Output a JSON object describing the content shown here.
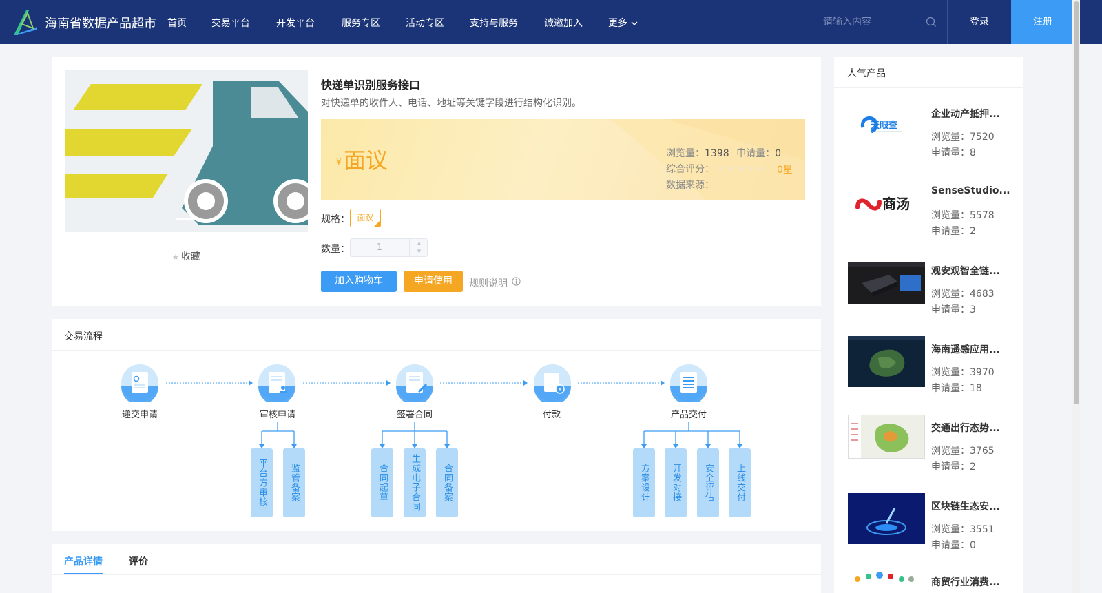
{
  "header": {
    "site_title": "海南省数据产品超市",
    "nav": [
      "首页",
      "交易平台",
      "开发平台",
      "服务专区",
      "活动专区",
      "支持与服务",
      "诚邀加入",
      "更多"
    ],
    "search_placeholder": "请输入内容",
    "login": "登录",
    "register": "注册"
  },
  "product": {
    "favorite": "收藏",
    "title": "快递单识别服务接口",
    "description": "对快递单的收件人、电话、地址等关键字段进行结构化识别。",
    "price_symbol": "¥",
    "price": "面议",
    "views_label": "浏览量：",
    "views": "1398",
    "applies_label": "申请量：",
    "applies": "0",
    "rating_label": "综合评分：",
    "rating_stars": 0,
    "rating_text": "0星",
    "source_label": "数据来源：",
    "spec_label": "规格：",
    "spec_option": "面议",
    "qty_label": "数量：",
    "qty_value": "1",
    "add_cart": "加入购物车",
    "apply": "申请使用",
    "rules": "规则说明"
  },
  "process": {
    "title": "交易流程",
    "steps": [
      "递交申请",
      "审核申请",
      "签署合同",
      "付款",
      "产品交付"
    ],
    "audit_sub": [
      "平台方审核",
      "监管备案"
    ],
    "contract_sub": [
      "合同起草",
      "生成电子合同",
      "合同备案"
    ],
    "delivery_sub": [
      "方案设计",
      "开发对接",
      "安全评估",
      "上线交付"
    ]
  },
  "tabs": [
    "产品详情",
    "评价"
  ],
  "sidebar": {
    "title": "人气产品",
    "views_label": "浏览量：",
    "applies_label": "申请量：",
    "items": [
      {
        "name": "企业动产抵押...",
        "views": "7520",
        "applies": "8",
        "logo": "天眼查"
      },
      {
        "name": "SenseStudio...",
        "views": "5578",
        "applies": "2",
        "logo": "商汤"
      },
      {
        "name": "观安观智全链...",
        "views": "4683",
        "applies": "3"
      },
      {
        "name": "海南遥感应用...",
        "views": "3970",
        "applies": "18"
      },
      {
        "name": "交通出行态势...",
        "views": "3765",
        "applies": "2"
      },
      {
        "name": "区块链生态安...",
        "views": "3551",
        "applies": "0"
      },
      {
        "name": "商贸行业消费...",
        "views": "",
        "applies": ""
      }
    ]
  },
  "colors": {
    "header": "#1b3478",
    "primary": "#3c9cf5",
    "accent": "#f5a623"
  }
}
